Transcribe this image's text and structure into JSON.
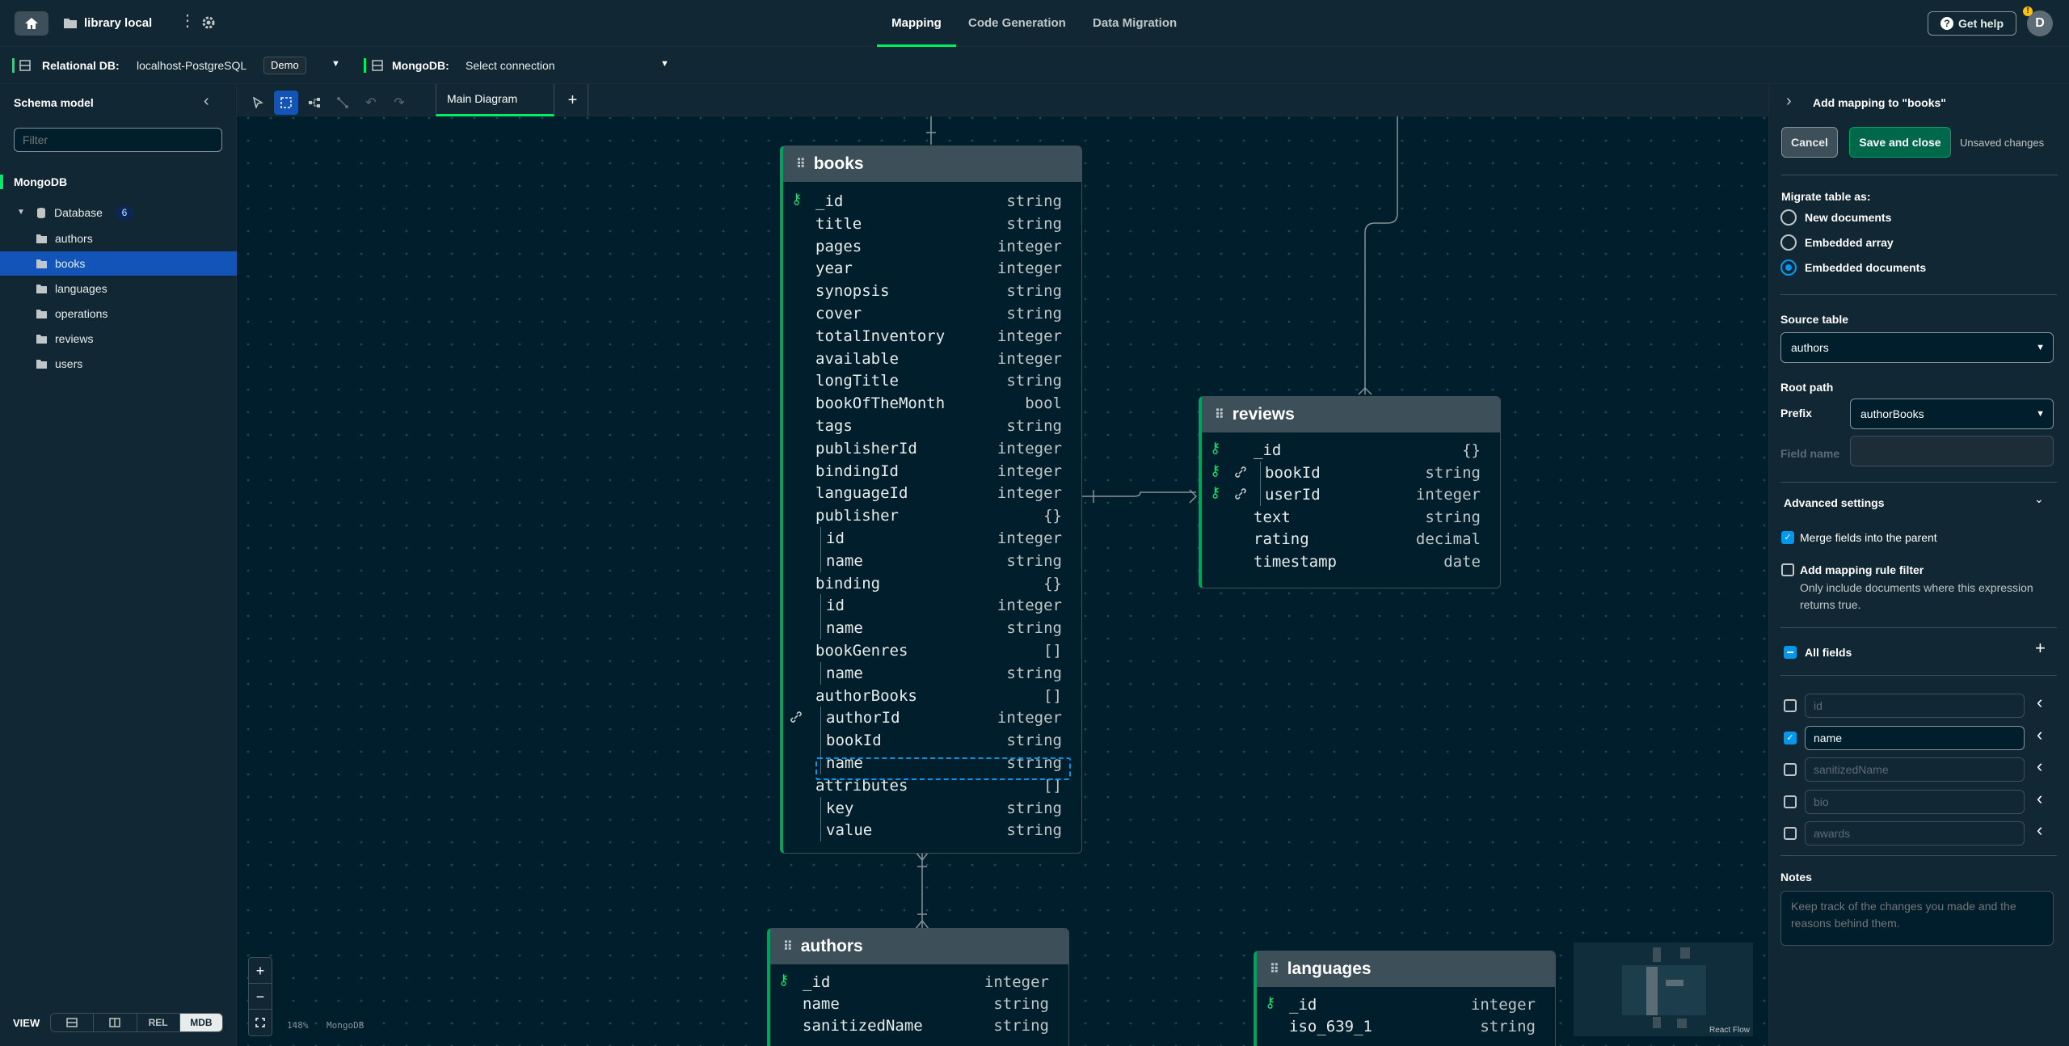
{
  "topbar": {
    "project_name": "library local",
    "tabs": [
      {
        "label": "Mapping",
        "active": true
      },
      {
        "label": "Code Generation",
        "active": false
      },
      {
        "label": "Data Migration",
        "active": false
      }
    ],
    "help_label": "Get help",
    "avatar_initial": "D"
  },
  "connections": {
    "relational_label": "Relational DB:",
    "relational_value": "localhost-PostgreSQL",
    "relational_badge": "Demo",
    "mongo_label": "MongoDB:",
    "mongo_value": "Select connection"
  },
  "sidebar": {
    "title": "Schema model",
    "filter_placeholder": "Filter",
    "section": "MongoDB",
    "database_label": "Database",
    "database_count": "6",
    "collections": [
      "authors",
      "books",
      "languages",
      "operations",
      "reviews",
      "users"
    ],
    "selected": "books",
    "view_label": "VIEW",
    "view_rel": "REL",
    "view_mdb": "MDB"
  },
  "canvas": {
    "diagram_tab": "Main Diagram",
    "zoom": "148%",
    "db_label": "MongoDB",
    "attribution": "React Flow"
  },
  "tables": {
    "books": {
      "name": "books",
      "fields": [
        {
          "name": "_id",
          "type": "string"
        },
        {
          "name": "title",
          "type": "string"
        },
        {
          "name": "pages",
          "type": "integer"
        },
        {
          "name": "year",
          "type": "integer"
        },
        {
          "name": "synopsis",
          "type": "string"
        },
        {
          "name": "cover",
          "type": "string"
        },
        {
          "name": "totalInventory",
          "type": "integer"
        },
        {
          "name": "available",
          "type": "integer"
        },
        {
          "name": "longTitle",
          "type": "string"
        },
        {
          "name": "bookOfTheMonth",
          "type": "bool"
        },
        {
          "name": "tags",
          "type": "string"
        },
        {
          "name": "publisherId",
          "type": "integer"
        },
        {
          "name": "bindingId",
          "type": "integer"
        },
        {
          "name": "languageId",
          "type": "integer"
        },
        {
          "name": "publisher",
          "type": "{}"
        },
        {
          "name": "id",
          "type": "integer"
        },
        {
          "name": "name",
          "type": "string"
        },
        {
          "name": "binding",
          "type": "{}"
        },
        {
          "name": "id",
          "type": "integer"
        },
        {
          "name": "name",
          "type": "string"
        },
        {
          "name": "bookGenres",
          "type": "[]"
        },
        {
          "name": "name",
          "type": "string"
        },
        {
          "name": "authorBooks",
          "type": "[]"
        },
        {
          "name": "authorId",
          "type": "integer"
        },
        {
          "name": "bookId",
          "type": "string"
        },
        {
          "name": "name",
          "type": "string"
        },
        {
          "name": "attributes",
          "type": "[]"
        },
        {
          "name": "key",
          "type": "string"
        },
        {
          "name": "value",
          "type": "string"
        }
      ]
    },
    "reviews": {
      "name": "reviews",
      "fields": [
        {
          "name": "_id",
          "type": "{}"
        },
        {
          "name": "bookId",
          "type": "string"
        },
        {
          "name": "userId",
          "type": "integer"
        },
        {
          "name": "text",
          "type": "string"
        },
        {
          "name": "rating",
          "type": "decimal"
        },
        {
          "name": "timestamp",
          "type": "date"
        }
      ]
    },
    "authors": {
      "name": "authors",
      "fields": [
        {
          "name": "_id",
          "type": "integer"
        },
        {
          "name": "name",
          "type": "string"
        },
        {
          "name": "sanitizedName",
          "type": "string"
        }
      ]
    },
    "languages": {
      "name": "languages",
      "fields": [
        {
          "name": "_id",
          "type": "integer"
        },
        {
          "name": "iso_639_1",
          "type": "string"
        }
      ]
    }
  },
  "panel": {
    "title": "Add mapping to \"books\"",
    "cancel_label": "Cancel",
    "save_label": "Save and close",
    "unsaved_label": "Unsaved changes",
    "migrate_label": "Migrate table as:",
    "migrate_options": [
      {
        "label": "New documents",
        "selected": false
      },
      {
        "label": "Embedded array",
        "selected": false
      },
      {
        "label": "Embedded documents",
        "selected": true
      }
    ],
    "source_table_label": "Source table",
    "source_table_value": "authors",
    "root_path_label": "Root path",
    "prefix_label": "Prefix",
    "prefix_value": "authorBooks",
    "field_name_label": "Field name",
    "advanced_label": "Advanced settings",
    "merge_label": "Merge fields into the parent",
    "merge_checked": true,
    "filter_rule_label": "Add mapping rule filter",
    "filter_rule_help": "Only include documents where this expression returns true.",
    "filter_rule_checked": false,
    "all_fields_label": "All fields",
    "fields": [
      {
        "name": "id",
        "checked": false
      },
      {
        "name": "name",
        "checked": true
      },
      {
        "name": "sanitizedName",
        "checked": false
      },
      {
        "name": "bio",
        "checked": false
      },
      {
        "name": "awards",
        "checked": false
      }
    ],
    "notes_label": "Notes",
    "notes_placeholder": "Keep track of the changes you made and the reasons behind them."
  },
  "colors": {
    "accent_green": "#00ed64",
    "selected_blue": "#1254b7",
    "save_green": "#00684a",
    "table_header": "#3d4f58"
  }
}
